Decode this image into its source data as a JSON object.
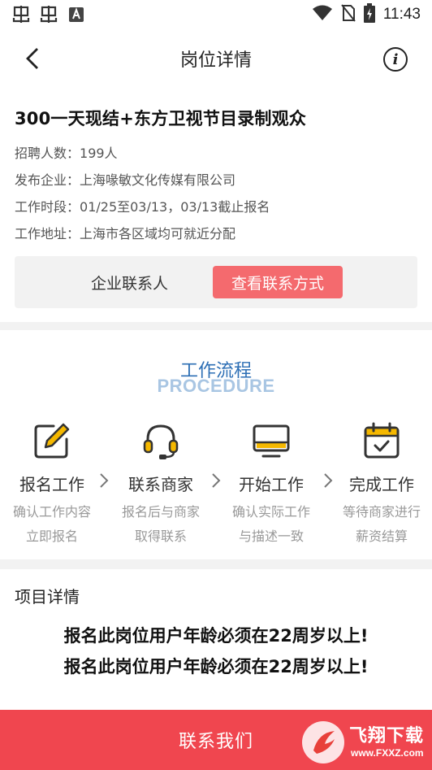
{
  "status_bar": {
    "time": "11:43",
    "app_icons": [
      "chong-icon",
      "chong-icon",
      "font-a-icon"
    ],
    "system_icons": [
      "wifi-icon",
      "no-sim-icon",
      "battery-charging-icon"
    ]
  },
  "nav": {
    "title": "岗位详情"
  },
  "job": {
    "title": "300一天现结+东方卫视节目录制观众",
    "recruit_label": "招聘人数：",
    "recruit_value": "199人",
    "company_label": "发布企业：",
    "company_value": "上海喙敏文化传媒有限公司",
    "period_label": "工作时段：",
    "period_value": "01/25至03/13，03/13截止报名",
    "address_label": "工作地址：",
    "address_value": "上海市各区域均可就近分配",
    "contact_label": "企业联系人",
    "contact_button": "查看联系方式"
  },
  "procedure": {
    "title": "工作流程",
    "subtitle": "PROCEDURE",
    "steps": [
      {
        "name": "报名工作",
        "desc1": "确认工作内容",
        "desc2": "立即报名",
        "icon": "edit-icon"
      },
      {
        "name": "联系商家",
        "desc1": "报名后与商家",
        "desc2": "取得联系",
        "icon": "headset-icon"
      },
      {
        "name": "开始工作",
        "desc1": "确认实际工作",
        "desc2": "与描述一致",
        "icon": "monitor-icon"
      },
      {
        "name": "完成工作",
        "desc1": "等待商家进行",
        "desc2": "薪资结算",
        "icon": "calendar-check-icon"
      }
    ]
  },
  "project": {
    "heading": "项目详情",
    "line1": "报名此岗位用户年龄必须在22周岁以上!",
    "line2": "报名此岗位用户年龄必须在22周岁以上!"
  },
  "bottom": {
    "label": "联系我们"
  },
  "watermark": {
    "text": "飞翔下载",
    "url": "www.FXXZ.com"
  },
  "colors": {
    "accent_red": "#f0464f",
    "button_pink": "#f46a6e",
    "icon_yellow": "#f5b800",
    "procedure_blue": "#2d6fb5",
    "procedure_light_blue": "#a9c6e3"
  }
}
